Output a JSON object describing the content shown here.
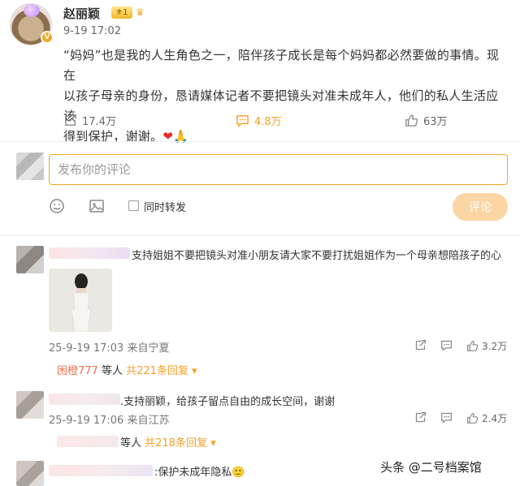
{
  "post": {
    "username": "赵丽颖",
    "level_badge": "1",
    "time": "9-19 17:02",
    "text_line1": "“妈妈”也是我的人生角色之一，陪伴孩子成长是每个妈妈都必然要做的事情。现在",
    "text_line2": "以孩子母亲的身份，恳请媒体记者不要把镜头对准未成年人，他们的私人生活应该",
    "text_line3": "得到保护，谢谢。",
    "text_emoji": "❤🙏",
    "actions": {
      "repost_count": "17.4万",
      "comment_count": "4.8万",
      "like_count": "63万"
    }
  },
  "composer": {
    "placeholder": "发布你的评论",
    "repost_label": "同时转发",
    "submit_label": "评论"
  },
  "comments": [
    {
      "text": "支持姐姐不要把镜头对准小朋友请大家不要打扰姐姐作为一个母亲想陪孩子的心",
      "meta": "25-9-19 17:03 来自宁夏",
      "like_count": "3.2万",
      "reply_prefix": "困橙777",
      "reply_mid": " 等人 ",
      "reply_count": "共221条回复 ▾"
    },
    {
      "text": ".支持丽颖，给孩子留点自由的成长空间，谢谢",
      "meta": "25-9-19 17:06 来自江苏",
      "like_count": "2.4万",
      "reply_prefix": "",
      "reply_mid": "等人 ",
      "reply_count": "共218条回复 ▾"
    },
    {
      "text": ":保护未成年隐私🙂"
    }
  ],
  "watermark": "头条 @二号档案馆",
  "colors": {
    "accent": "#f7a027",
    "button_disabled": "#fbd5a3",
    "focus_border": "#f6a623"
  }
}
